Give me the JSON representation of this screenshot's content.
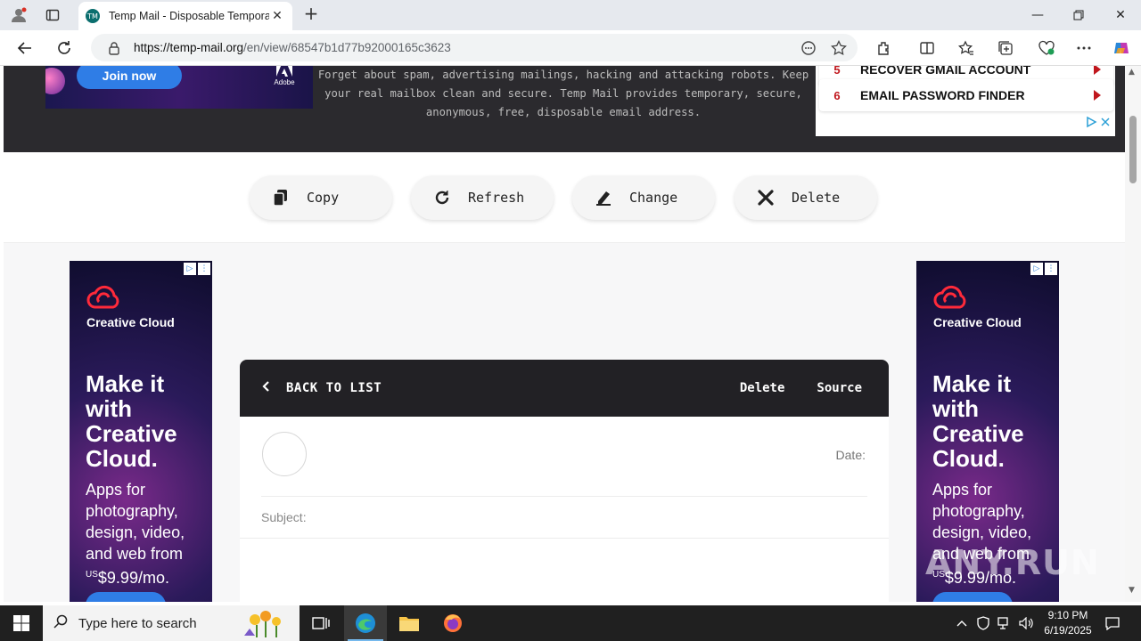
{
  "browser": {
    "tab_title": "Temp Mail - Disposable Temporary Email",
    "tab_favicon": "TM",
    "url_host": "https://temp-mail.org",
    "url_path": "/en/view/68547b1d77b92000165c3623"
  },
  "hero": {
    "ad_join": "Join now",
    "ad_brand": "Adobe",
    "description": "Forget about spam, advertising mailings, hacking and attacking robots. Keep your real mailbox clean and secure. Temp Mail provides temporary, secure, anonymous, free, disposable email address.",
    "side_items": [
      {
        "num": "5",
        "label": "RECOVER GMAIL ACCOUNT"
      },
      {
        "num": "6",
        "label": "EMAIL PASSWORD FINDER"
      }
    ]
  },
  "actions": {
    "copy": "Copy",
    "refresh": "Refresh",
    "change": "Change",
    "delete": "Delete"
  },
  "side_ad": {
    "brand": "Creative Cloud",
    "headline": "Make it with Creative Cloud.",
    "body": "Apps for photography, design, video, and web from",
    "price_prefix": "US",
    "price": "$9.99/mo."
  },
  "mail": {
    "back_label": "BACK TO LIST",
    "delete_label": "Delete",
    "source_label": "Source",
    "date_label": "Date:",
    "subject_label": "Subject:"
  },
  "watermark": "ANY.RUN",
  "taskbar": {
    "search_placeholder": "Type here to search",
    "time": "9:10 PM",
    "date": "6/19/2025"
  },
  "colors": {
    "accent_red": "#c0161c",
    "header_dark": "#222125",
    "hero_dark": "#2b2a2e",
    "adobe_blue": "#2f7de6"
  }
}
